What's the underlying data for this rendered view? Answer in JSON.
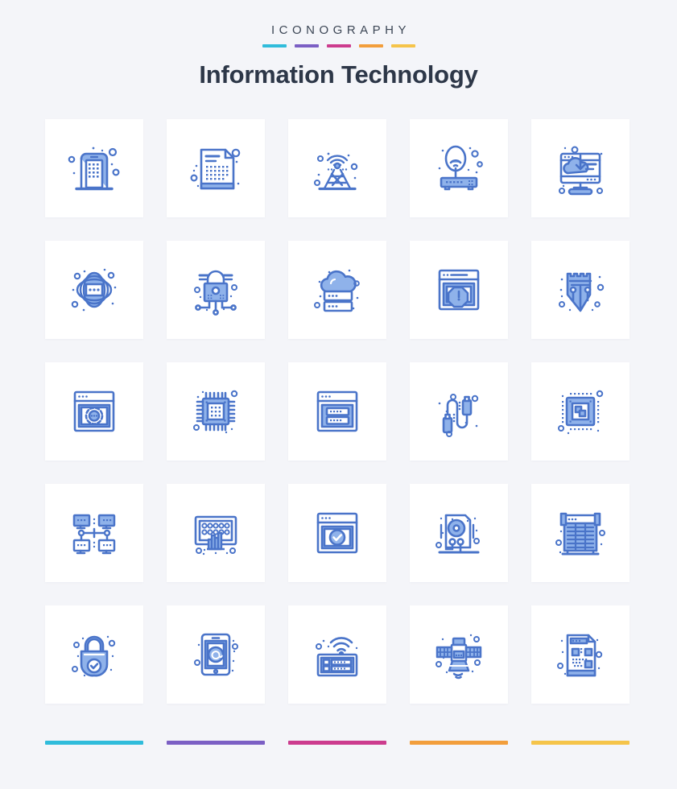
{
  "header": {
    "kicker": "ICONOGRAPHY",
    "title": "Information Technology",
    "kicker_color": "#3c4655",
    "title_color": "#2d3748"
  },
  "palette": {
    "background": "#f4f5f9",
    "card": "#ffffff",
    "icon_stroke": "#4a74c9",
    "icon_fill": "#8fb2ea",
    "icon_fill_light": "#b9cef3"
  },
  "accent_bars": [
    {
      "name": "cyan",
      "color": "#30bcdb"
    },
    {
      "name": "purple",
      "color": "#7b5fc4"
    },
    {
      "name": "magenta",
      "color": "#cc3c8e"
    },
    {
      "name": "orange",
      "color": "#f29e3c"
    },
    {
      "name": "yellow",
      "color": "#f5c44a"
    }
  ],
  "icons": [
    {
      "row": 1,
      "col": 1,
      "name": "smartphone-keypad-icon",
      "label": "Mobile Device"
    },
    {
      "row": 1,
      "col": 2,
      "name": "data-document-icon",
      "label": "Data Document"
    },
    {
      "row": 1,
      "col": 3,
      "name": "antenna-tower-icon",
      "label": "Antenna Tower"
    },
    {
      "row": 1,
      "col": 4,
      "name": "wifi-router-icon",
      "label": "Wireless Router"
    },
    {
      "row": 1,
      "col": 5,
      "name": "cloud-download-monitor-icon",
      "label": "Cloud Download"
    },
    {
      "row": 2,
      "col": 1,
      "name": "global-network-icon",
      "label": "Global Network"
    },
    {
      "row": 2,
      "col": 2,
      "name": "secure-lock-circuit-icon",
      "label": "Network Security"
    },
    {
      "row": 2,
      "col": 3,
      "name": "cloud-server-icon",
      "label": "Cloud Server"
    },
    {
      "row": 2,
      "col": 4,
      "name": "browser-error-icon",
      "label": "Browser Error"
    },
    {
      "row": 2,
      "col": 5,
      "name": "security-shield-icon",
      "label": "Security Shield"
    },
    {
      "row": 3,
      "col": 1,
      "name": "browser-globe-icon",
      "label": "Web Browser"
    },
    {
      "row": 3,
      "col": 2,
      "name": "cpu-chip-icon",
      "label": "Processor"
    },
    {
      "row": 3,
      "col": 3,
      "name": "browser-server-icon",
      "label": "Web Hosting"
    },
    {
      "row": 3,
      "col": 4,
      "name": "usb-cable-icon",
      "label": "USB Cable"
    },
    {
      "row": 3,
      "col": 5,
      "name": "microchip-icon",
      "label": "Microchip"
    },
    {
      "row": 4,
      "col": 1,
      "name": "computer-network-icon",
      "label": "Computer Network"
    },
    {
      "row": 4,
      "col": 2,
      "name": "analytics-monitor-icon",
      "label": "Analytics"
    },
    {
      "row": 4,
      "col": 3,
      "name": "browser-verified-icon",
      "label": "Verified Site"
    },
    {
      "row": 4,
      "col": 4,
      "name": "hard-disk-icon",
      "label": "Hard Disk"
    },
    {
      "row": 4,
      "col": 5,
      "name": "server-rack-icon",
      "label": "Server Rack"
    },
    {
      "row": 5,
      "col": 1,
      "name": "lock-verified-icon",
      "label": "Protected"
    },
    {
      "row": 5,
      "col": 2,
      "name": "tablet-email-icon",
      "label": "Email Device"
    },
    {
      "row": 5,
      "col": 3,
      "name": "wifi-server-icon",
      "label": "Wireless Server"
    },
    {
      "row": 5,
      "col": 4,
      "name": "satellite-icon",
      "label": "Satellite"
    },
    {
      "row": 5,
      "col": 5,
      "name": "qr-document-icon",
      "label": "QR Document"
    }
  ]
}
